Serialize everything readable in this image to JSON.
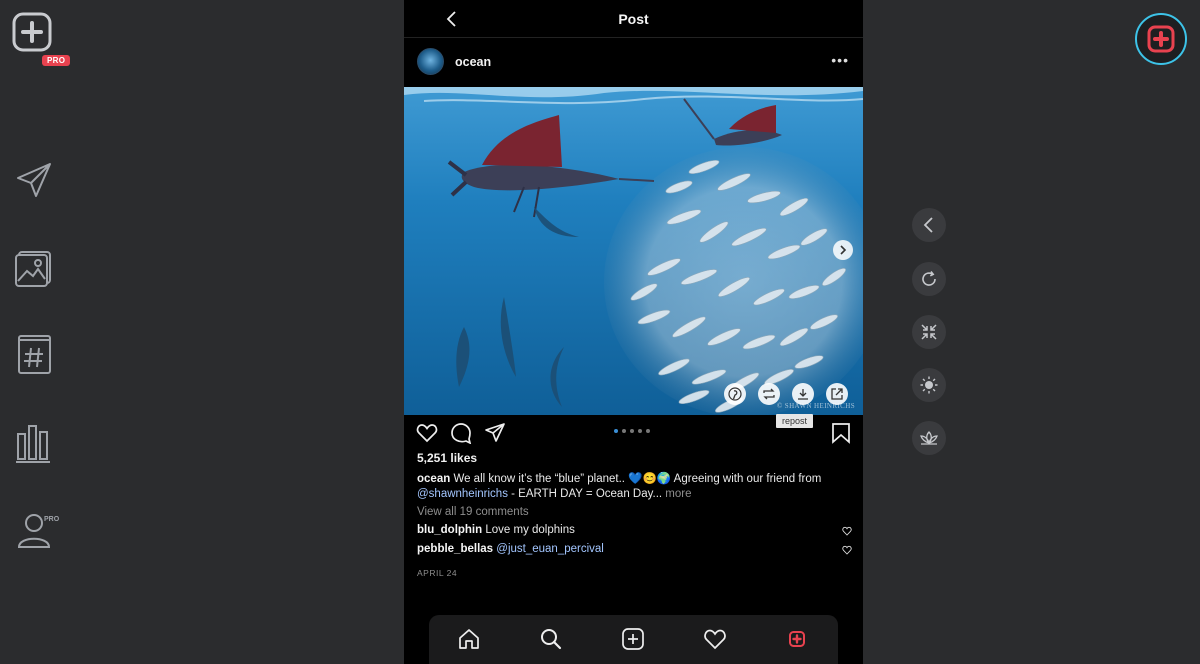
{
  "sidebar": {
    "pro_badge": "PRO",
    "profile_pro": "PRO"
  },
  "post": {
    "header_title": "Post",
    "author": "ocean",
    "more_label": "•••",
    "likes": "5,251 likes",
    "caption_author": "ocean",
    "caption_text": " We all know it’s the “blue” planet.. 💙😊🌍 Agreeing with our friend from ",
    "caption_mention": "@shawnheinrichs",
    "caption_text2": " - EARTH DAY = Ocean Day... ",
    "caption_more": "more",
    "view_comments": "View all 19 comments",
    "comments": [
      {
        "user": "blu_dolphin",
        "text": " Love my dolphins"
      },
      {
        "user": "pebble_bellas",
        "mention": "@just_euan_percival"
      }
    ],
    "date": "APRIL 24",
    "photo_credit": "© SHAWN HEINRICHS",
    "repost_tooltip": "repost",
    "carousel": {
      "count": 5,
      "active": 0
    }
  },
  "colors": {
    "accent": "#e8424f",
    "ring": "#3dc3e8",
    "link": "#a3c6ff"
  },
  "icons": {
    "left": [
      "send-icon",
      "gallery-icon",
      "hashtag-icon",
      "stats-icon",
      "profile-icon"
    ],
    "right": [
      "chevron-left-icon",
      "refresh-icon",
      "collapse-icon",
      "brightness-icon",
      "lotus-icon"
    ],
    "nav": [
      "home-icon",
      "search-icon",
      "add-icon",
      "heart-icon",
      "app-icon"
    ]
  }
}
